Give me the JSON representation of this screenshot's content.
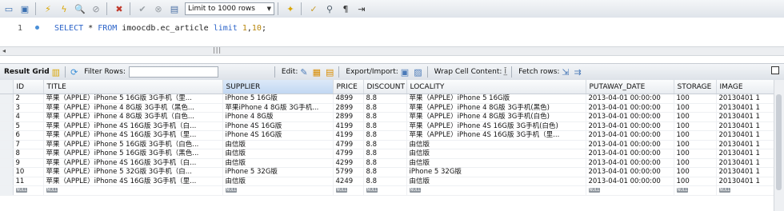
{
  "toolbar": {
    "icons": [
      "open-folder-icon",
      "save-icon",
      "execute-icon",
      "execute-selection-icon",
      "explain-icon",
      "stop-icon",
      "toggle-error-icon",
      "commit-icon",
      "rollback-icon",
      "autocommit-icon",
      "beautify-icon",
      "find-icon",
      "invisible-chars-icon",
      "wrap-icon"
    ],
    "limit_value": "Limit to 1000 rows"
  },
  "editor": {
    "line_number": "1",
    "sql_keyword1": "SELECT",
    "sql_star": " * ",
    "sql_keyword2": "FROM",
    "sql_table": " imoocdb.ec_article ",
    "sql_keyword3": "limit",
    "sql_space": " ",
    "sql_num1": "1",
    "sql_comma": ",",
    "sql_num2": "10",
    "sql_end": ";"
  },
  "results_toolbar": {
    "result_grid": "Result Grid",
    "filter_rows": "Filter Rows:",
    "filter_value": "",
    "edit": "Edit:",
    "export_import": "Export/Import:",
    "wrap_cell": "Wrap Cell Content:",
    "fetch_rows": "Fetch rows:"
  },
  "grid": {
    "columns": [
      "ID",
      "TITLE",
      "SUPPLIER",
      "PRICE",
      "DISCOUNT",
      "LOCALITY",
      "PUTAWAY_DATE",
      "STORAGE",
      "IMAGE"
    ],
    "rows": [
      [
        "2",
        "苹果（APPLE）iPhone 5 16G版 3G手机（里...",
        "iPhone 5 16G版",
        "4899",
        "8.8",
        "苹果（APPLE）iPhone 5 16G版",
        "2013-04-01 00:00:00",
        "100",
        "20130401 1"
      ],
      [
        "3",
        "苹果（APPLE）iPhone 4 8G版 3G手机（黑色...",
        "苹果iPhone 4 8G版 3G手机...",
        "2899",
        "8.8",
        "苹果（APPLE）iPhone 4 8G版 3G手机(黑色)",
        "2013-04-01 00:00:00",
        "100",
        "20130401 1"
      ],
      [
        "4",
        "苹果（APPLE）iPhone 4 8G版 3G手机（白色...",
        "iPhone 4 8G版",
        "2899",
        "8.8",
        "苹果（APPLE）iPhone 4 8G版 3G手机(白色)",
        "2013-04-01 00:00:00",
        "100",
        "20130401 1"
      ],
      [
        "5",
        "苹果（APPLE）iPhone 4S 16G版 3G手机（白...",
        "iPhone 4S 16G版",
        "4199",
        "8.8",
        "苹果（APPLE）iPhone 4S 16G版 3G手机(白色)",
        "2013-04-01 00:00:00",
        "100",
        "20130401 1"
      ],
      [
        "6",
        "苹果（APPLE）iPhone 4S 16G版 3G手机（里...",
        "iPhone 4S 16G版",
        "4199",
        "8.8",
        "苹果（APPLE）iPhone 4S 16G版 3G手机（里...",
        "2013-04-01 00:00:00",
        "100",
        "20130401 1"
      ],
      [
        "7",
        "苹果（APPLE）iPhone 5 16G版 3G手机（白色...",
        "由信版",
        "4799",
        "8.8",
        "由信版",
        "2013-04-01 00:00:00",
        "100",
        "20130401 1"
      ],
      [
        "8",
        "苹果（APPLE）iPhone 5 16G版 3G手机（黑色...",
        "由信版",
        "4799",
        "8.8",
        "由信版",
        "2013-04-01 00:00:00",
        "100",
        "20130401 1"
      ],
      [
        "9",
        "苹果（APPLE）iPhone 4S 16G版 3G手机（白...",
        "由信版",
        "4299",
        "8.8",
        "由信版",
        "2013-04-01 00:00:00",
        "100",
        "20130401 1"
      ],
      [
        "10",
        "苹果（APPLE）iPhone 5 32G版 3G手机（白...",
        "iPhone 5 32G版",
        "5799",
        "8.8",
        "iPhone 5 32G版",
        "2013-04-01 00:00:00",
        "100",
        "20130401 1"
      ],
      [
        "11",
        "苹果（APPLE）iPhone 4S 16G版 3G手机（里...",
        "由信版",
        "4249",
        "8.8",
        "由信版",
        "2013-04-01 00:00:00",
        "100",
        "20130401 1"
      ]
    ],
    "null_label": "NULL",
    "selected_column": "SUPPLIER"
  },
  "colors": {
    "keyword": "#2c64c9",
    "number": "#b8860b",
    "selected_header": "#c2d8f2"
  }
}
